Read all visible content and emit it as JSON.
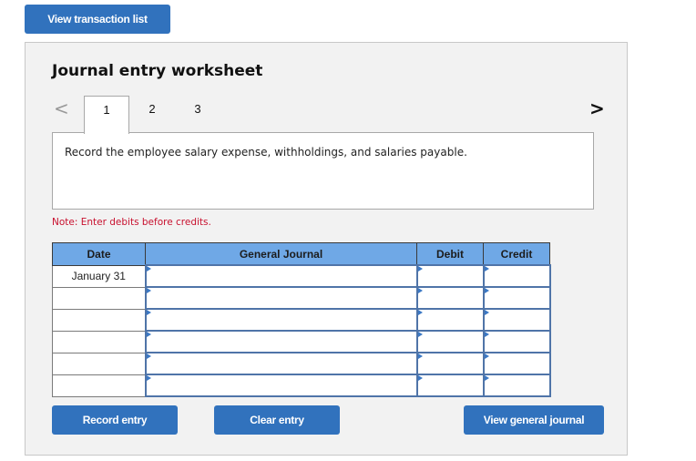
{
  "top_button": {
    "label": "View transaction list"
  },
  "worksheet": {
    "title": "Journal entry worksheet",
    "nav": {
      "prev_icon": "chevron-left-icon",
      "next_icon": "chevron-right-icon",
      "prev_glyph": "<",
      "next_glyph": ">"
    },
    "tabs": [
      {
        "label": "1",
        "active": true
      },
      {
        "label": "2",
        "active": false
      },
      {
        "label": "3",
        "active": false
      }
    ],
    "description": "Record the employee salary expense, withholdings, and salaries payable.",
    "note": "Note: Enter debits before credits.",
    "table": {
      "columns": [
        "Date",
        "General Journal",
        "Debit",
        "Credit"
      ],
      "rows": [
        {
          "date": "January 31",
          "account": "",
          "debit": "",
          "credit": ""
        },
        {
          "date": "",
          "account": "",
          "debit": "",
          "credit": ""
        },
        {
          "date": "",
          "account": "",
          "debit": "",
          "credit": ""
        },
        {
          "date": "",
          "account": "",
          "debit": "",
          "credit": ""
        },
        {
          "date": "",
          "account": "",
          "debit": "",
          "credit": ""
        },
        {
          "date": "",
          "account": "",
          "debit": "",
          "credit": ""
        }
      ]
    },
    "buttons": {
      "record": "Record entry",
      "clear": "Clear entry",
      "view_journal": "View general journal"
    },
    "colors": {
      "button_blue": "#3172bd",
      "header_blue": "#6fa8e6",
      "note_red": "#c8102e"
    }
  }
}
